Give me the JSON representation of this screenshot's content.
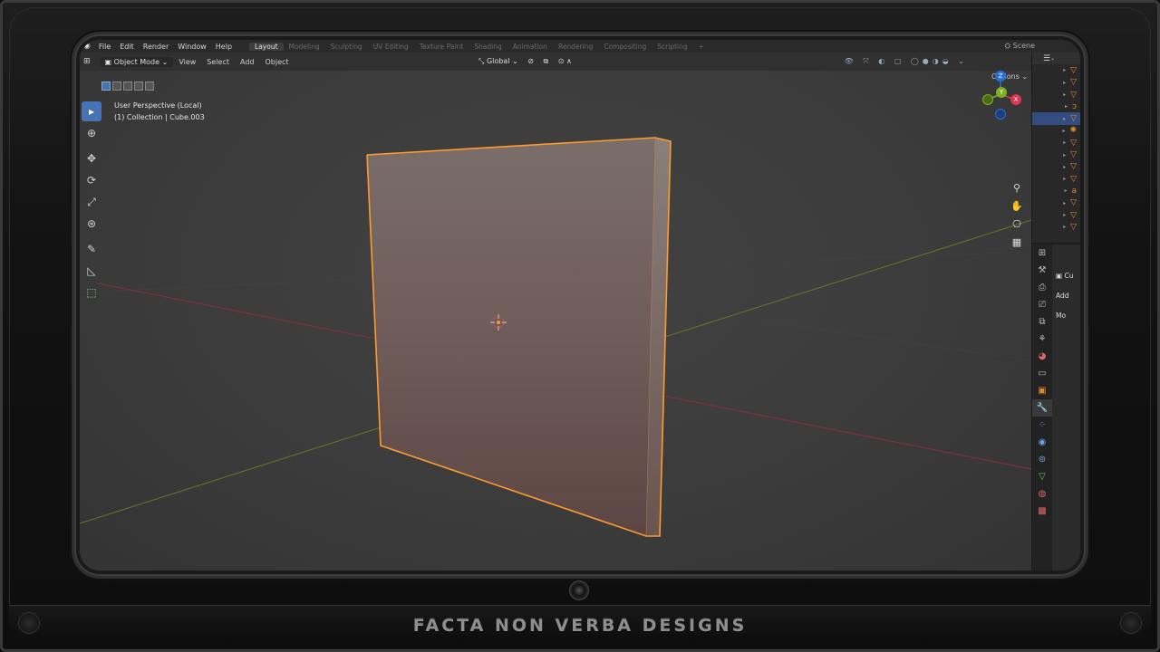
{
  "topbar": {
    "menus": [
      "File",
      "Edit",
      "Render",
      "Window",
      "Help"
    ],
    "workspaces": [
      "Layout",
      "Modeling",
      "Sculpting",
      "UV Editing",
      "Texture Paint",
      "Shading",
      "Animation",
      "Rendering",
      "Compositing",
      "Scripting"
    ],
    "active_workspace": "Layout",
    "add_tab": "+",
    "scene": "Scene"
  },
  "header": {
    "mode": "Object Mode",
    "menus": [
      "View",
      "Select",
      "Add",
      "Object"
    ],
    "orientation": "Global",
    "options": "Options"
  },
  "viewport": {
    "view_name": "User Perspective (Local)",
    "collection_info": "(1) Collection | Cube.003",
    "gizmo_axis": {
      "z": "Z",
      "y": "Y",
      "x": "X"
    }
  },
  "toolbar": {
    "tools": [
      "select-box",
      "cursor",
      "move",
      "rotate",
      "scale",
      "transform",
      "annotate",
      "measure",
      "add-cube"
    ],
    "active": "select-box"
  },
  "properties": {
    "object_name": "Cu",
    "add_modifier": "Add Mo",
    "active_tab": "modifier"
  },
  "colors": {
    "selection": "#ff9a2e",
    "active_blue": "#4772b3",
    "x_axis": "#b3344a",
    "y_axis": "#6a8e23",
    "z_axis": "#2a6fd6"
  },
  "branding": "FACTA NON VERBA DESIGNS"
}
